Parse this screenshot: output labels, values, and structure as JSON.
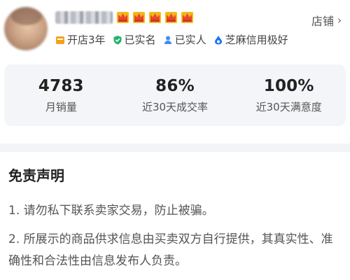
{
  "seller": {
    "avatar_icon": "user-avatar-blurred",
    "name": "",
    "crowns": [
      "crown-icon",
      "crown-icon",
      "crown-icon",
      "crown-icon",
      "crown-icon"
    ],
    "store_link": {
      "label": "店铺",
      "chevron": "›"
    },
    "badges": [
      {
        "icon": "shop-icon",
        "label": "开店3年",
        "color": "#f2a21b"
      },
      {
        "icon": "verified-shield-icon",
        "label": "已实名",
        "color": "#23b26d"
      },
      {
        "icon": "person-icon",
        "label": "已实人",
        "color": "#3f8cf5"
      },
      {
        "icon": "sesame-drop-icon",
        "label": "芝麻信用极好",
        "color": "#1a74f2"
      }
    ]
  },
  "stats": [
    {
      "value": "4783",
      "label": "月销量"
    },
    {
      "value": "86%",
      "label": "近30天成交率"
    },
    {
      "value": "100%",
      "label": "近30天满意度"
    }
  ],
  "disclaimer": {
    "title": "免责声明",
    "items": [
      "1. 请勿私下联系卖家交易，防止被骗。",
      "2. 所展示的商品供求信息由买卖双方自行提供，其真实性、准确性和合法性由信息发布人负责。"
    ]
  },
  "colors": {
    "crown": "#e8472c",
    "crown_gold": "#f6b51a",
    "stats_bg": "#f4f5f8"
  }
}
